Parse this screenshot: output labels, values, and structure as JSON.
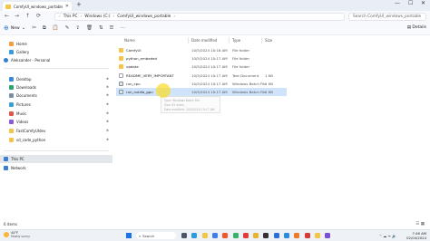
{
  "window": {
    "tab_title": "ComfyUI_windows_portable",
    "tab_close": "✕",
    "new_tab": "+",
    "controls": {
      "minimize": "—",
      "maximize": "☐",
      "close": "✕"
    }
  },
  "navigation": {
    "back": "←",
    "forward": "→",
    "up": "↑",
    "refresh": "⟳",
    "breadcrumb": [
      "This PC",
      "Windows (C:)",
      "ComfyUI_windows_portable"
    ],
    "separator": "›",
    "search_placeholder": "Search ComfyUI_windows_portable"
  },
  "commandbar": {
    "new_label": "New",
    "new_icon": "plus-icon",
    "details_label": "Details"
  },
  "sidebar": {
    "quick": [
      {
        "label": "Home",
        "icon": "home-icon",
        "color": "#f59b42"
      },
      {
        "label": "Gallery",
        "icon": "gallery-icon",
        "color": "#3a9ad9"
      },
      {
        "label": "Aleksander - Personal",
        "icon": "onedrive-icon",
        "color": "#2f7fd1"
      }
    ],
    "pinned": [
      {
        "label": "Desktop",
        "color": "#3d8bd8"
      },
      {
        "label": "Downloads",
        "color": "#2ba46f"
      },
      {
        "label": "Documents",
        "color": "#7a8ea8"
      },
      {
        "label": "Pictures",
        "color": "#3aa0d6"
      },
      {
        "label": "Music",
        "color": "#e0564c"
      },
      {
        "label": "Videos",
        "color": "#8b5cd6"
      },
      {
        "label": "FastComfyUIdev",
        "color": "#f3c64a"
      },
      {
        "label": "sd_code_python",
        "color": "#f3c64a"
      }
    ],
    "pin_glyph": "✱",
    "this_pc": {
      "label": "This PC",
      "color": "#3b7fd6"
    },
    "network": {
      "label": "Network",
      "color": "#3b7fd6"
    }
  },
  "filelist": {
    "columns": {
      "name": "Name",
      "date": "Date modified",
      "type": "Type",
      "size": "Size"
    },
    "rows": [
      {
        "name": "ComfyUI",
        "date": "10/5/2024 10:16 AM",
        "type": "File folder",
        "size": "",
        "kind": "folder"
      },
      {
        "name": "python_embeded",
        "date": "10/5/2024 10:17 AM",
        "type": "File folder",
        "size": "",
        "kind": "folder"
      },
      {
        "name": "update",
        "date": "10/5/2024 10:17 AM",
        "type": "File folder",
        "size": "",
        "kind": "folder"
      },
      {
        "name": "README_VERY_IMPORTANT",
        "date": "10/5/2024 10:17 AM",
        "type": "Text Document",
        "size": "1 KB",
        "kind": "txt"
      },
      {
        "name": "run_cpu",
        "date": "10/5/2024 10:17 AM",
        "type": "Windows Batch File",
        "size": "1 KB",
        "kind": "bat"
      },
      {
        "name": "run_nvidia_gpu",
        "date": "10/5/2024 10:17 AM",
        "type": "Windows Batch File",
        "size": "1 KB",
        "kind": "bat",
        "selected": true
      }
    ],
    "tooltip": [
      "Type: Windows Batch File",
      "Size: 82 bytes",
      "Date modified: 10/5/2024 10:17 AM"
    ]
  },
  "status": {
    "items": "6 items",
    "view_icons": "☰ ▦"
  },
  "taskbar": {
    "weather_temp": "44°F",
    "weather_desc": "Mostly sunny",
    "search_label": "Search",
    "search_icon": "search-icon",
    "apps": [
      {
        "name": "taskview-icon",
        "color": "#4a5568"
      },
      {
        "name": "edge-icon",
        "color": "#2b9be0"
      },
      {
        "name": "files-icon",
        "color": "#f3c64a"
      },
      {
        "name": "store-icon",
        "color": "#3f7ee8"
      },
      {
        "name": "brave-icon",
        "color": "#f0572b"
      },
      {
        "name": "green-app-icon",
        "color": "#35b36a"
      },
      {
        "name": "red-app-icon",
        "color": "#e23b3b"
      },
      {
        "name": "chrome-icon",
        "color": "#e8b42b"
      },
      {
        "name": "terminal-icon",
        "color": "#333333"
      },
      {
        "name": "blue-app-icon",
        "color": "#2c6fd6"
      },
      {
        "name": "vscode-icon",
        "color": "#2a8ae0"
      },
      {
        "name": "orange-app-icon",
        "color": "#ee7a2c"
      },
      {
        "name": "red-app-2-icon",
        "color": "#d43b3b"
      },
      {
        "name": "folder-app-icon",
        "color": "#f3c64a"
      },
      {
        "name": "purple-app-icon",
        "color": "#7a4fd1"
      }
    ],
    "tray_icons": "⌃  ☁  ᯤ  🔊",
    "time": "7:46 AM",
    "date": "02/04/2024"
  }
}
